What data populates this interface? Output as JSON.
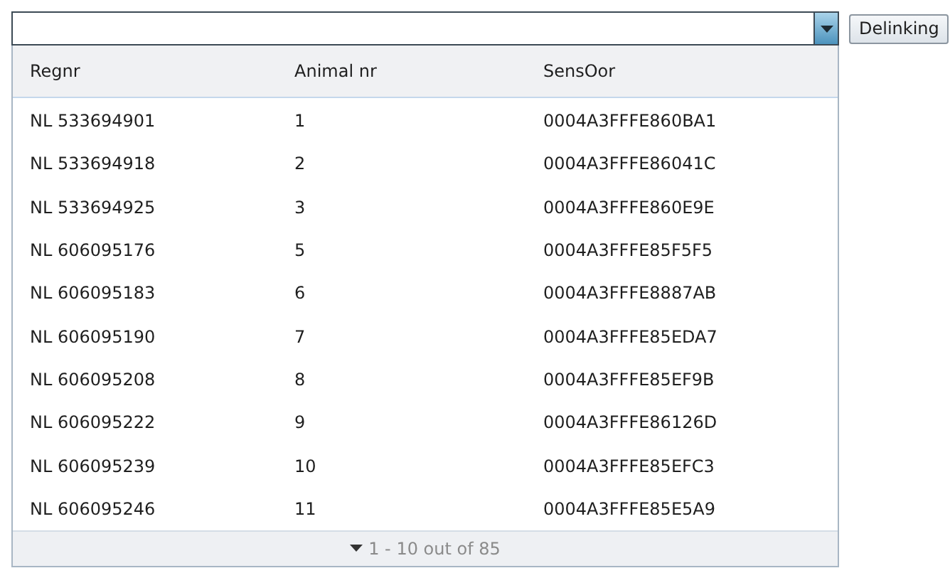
{
  "button": {
    "label": "Delinking"
  },
  "table": {
    "columns": [
      "Regnr",
      "Animal nr",
      "SensOor"
    ],
    "rows": [
      [
        "NL 533694901",
        "1",
        "0004A3FFFE860BA1"
      ],
      [
        "NL 533694918",
        "2",
        "0004A3FFFE86041C"
      ],
      [
        "NL 533694925",
        "3",
        "0004A3FFFE860E9E"
      ],
      [
        "NL 606095176",
        "5",
        "0004A3FFFE85F5F5"
      ],
      [
        "NL 606095183",
        "6",
        "0004A3FFFE8887AB"
      ],
      [
        "NL 606095190",
        "7",
        "0004A3FFFE85EDA7"
      ],
      [
        "NL 606095208",
        "8",
        "0004A3FFFE85EF9B"
      ],
      [
        "NL 606095222",
        "9",
        "0004A3FFFE86126D"
      ],
      [
        "NL 606095239",
        "10",
        "0004A3FFFE85EFC3"
      ],
      [
        "NL 606095246",
        "11",
        "0004A3FFFE85E5A9"
      ]
    ]
  },
  "footer": {
    "text": "1 - 10 out of 85"
  }
}
